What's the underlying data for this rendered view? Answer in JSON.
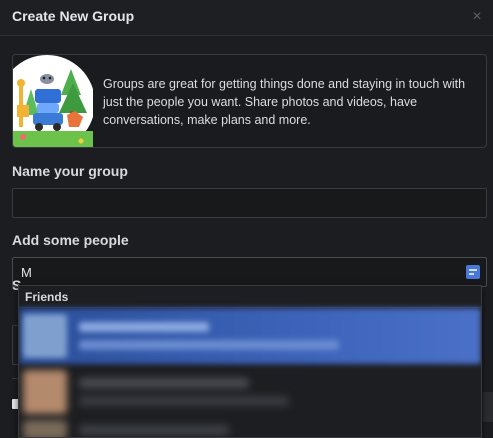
{
  "dialog": {
    "title": "Create New Group",
    "close_symbol": "×"
  },
  "intro": {
    "text": "Groups are great for getting things done and staying in touch with just the people you want. Share photos and videos, have conversations, make plans and more."
  },
  "form": {
    "name_label": "Name your group",
    "name_value": "",
    "people_label": "Add some people",
    "people_value": "M",
    "partially_hidden_label": "S"
  },
  "dropdown": {
    "section_header": "Friends"
  },
  "icons": {
    "compose": "compose-icon",
    "close": "close-icon"
  },
  "colors": {
    "accent": "#4a78d9",
    "highlight_row": "#3c63b9"
  }
}
